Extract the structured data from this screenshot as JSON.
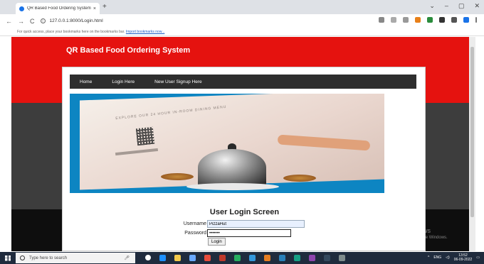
{
  "browser": {
    "tab_title": "QR Based Food Ordering System",
    "tab_close": "×",
    "new_tab": "+",
    "url": "127.0.0.1:8000/Login.html",
    "bookmarks_hint": "For quick access, place your bookmarks here on the bookmarks bar.",
    "bookmarks_link": "Import bookmarks now...",
    "window_controls": [
      "⌄",
      "–",
      "▢",
      "✕"
    ]
  },
  "site": {
    "title": "QR Based Food Ordering System",
    "nav": [
      "Home",
      "Login Here",
      "New User Signup Here"
    ]
  },
  "banner": {
    "tagline": "EXPLORE OUR 24 HOUR IN-ROOM DINING MENU"
  },
  "login": {
    "title": "User Login Screen",
    "username_label": "Username",
    "username_value": "PizzaHut",
    "password_label": "Password",
    "password_value": "•••••••",
    "button": "Login"
  },
  "watermark": {
    "title": "Activate Windows",
    "subtitle": "Go to Settings to activate Windows."
  },
  "taskbar": {
    "search_placeholder": "Type here to search",
    "tray_lang": "ENG",
    "time": "13:52",
    "date": "06-09-2022"
  },
  "colors": {
    "header_red": "#e5120f",
    "nav_dark": "#2e2e2e",
    "taskbar": "#1f2b3d"
  }
}
